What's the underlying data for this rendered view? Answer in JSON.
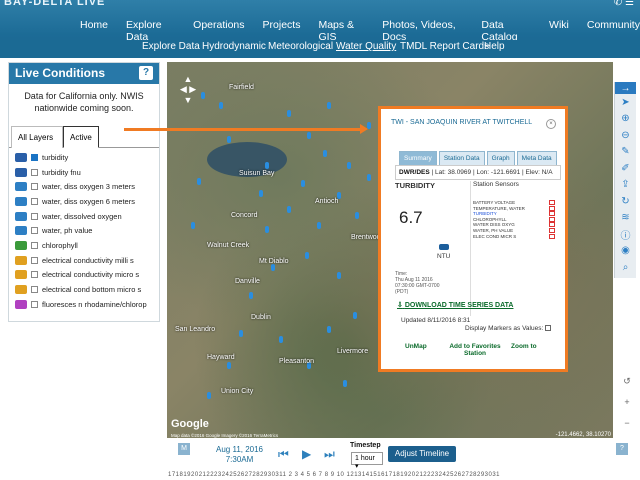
{
  "header": {
    "brand": "BAY-DELTA LIVE",
    "nav_primary": [
      "Home",
      "Explore Data",
      "Operations",
      "Projects",
      "Maps & GIS",
      "Photos, Videos, Docs",
      "Data Catalog",
      "Wiki",
      "Community"
    ],
    "nav_secondary": [
      "Explore Data",
      "Hydrodynamic",
      "Meteorological",
      "Water Quality",
      "TMDL Report Cards",
      "Help"
    ],
    "active_secondary": "Water Quality"
  },
  "panel": {
    "title": "Live Conditions",
    "help": "?",
    "note": "Data for California only. NWIS nationwide coming soon.",
    "tabs": [
      "All Layers",
      "Active"
    ],
    "layers": [
      {
        "label": "turbidity",
        "checked": true,
        "icon_color": "#2a5fa8"
      },
      {
        "label": "turbidity fnu",
        "checked": false,
        "icon_color": "#2a5fa8"
      },
      {
        "label": "water, diss oxygen 3 meters",
        "checked": false,
        "icon_color": "#2d7fc4"
      },
      {
        "label": "water, diss oxygen 6 meters",
        "checked": false,
        "icon_color": "#2d7fc4"
      },
      {
        "label": "water, dissolved oxygen",
        "checked": false,
        "icon_color": "#2d7fc4"
      },
      {
        "label": "water, ph value",
        "checked": false,
        "icon_color": "#2d7fc4"
      },
      {
        "label": "chlorophyll",
        "checked": false,
        "icon_color": "#3a9a3a"
      },
      {
        "label": "electrical conductivity milli s",
        "checked": false,
        "icon_color": "#e0a020"
      },
      {
        "label": "electrical conductivity micro s",
        "checked": false,
        "icon_color": "#e0a020"
      },
      {
        "label": "electrical cond bottom micro s",
        "checked": false,
        "icon_color": "#e0a020"
      },
      {
        "label": "fluoresces n rhodamine/chlorop",
        "checked": false,
        "icon_color": "#b040c0"
      }
    ]
  },
  "map": {
    "labels": [
      "Fairfield",
      "Suisun Bay",
      "Concord",
      "Walnut Creek",
      "Antioch",
      "Brentwood",
      "Pleasanton",
      "Livermore",
      "Hayward",
      "San Leandro",
      "Mt Diablo",
      "Union City",
      "Dublin",
      "Danville"
    ],
    "google": "Google",
    "attribution": "Map data ©2016 Google Imagery ©2016 TerraMetrics",
    "coords": "-121.4662, 38.10270"
  },
  "popup": {
    "title": "TWI - SAN JOAQUIN RIVER AT TWITCHELL",
    "close": "×",
    "tabs": [
      "Summary",
      "Station Data",
      "Graph",
      "Meta Data"
    ],
    "active_tab": "Summary",
    "info_source": "DWR/DES",
    "info_rest": "| Lat: 38.0969 | Lon: -121.6691 | Elev: N/A",
    "parameter": "TURBIDITY",
    "value": "6.7",
    "unit": "NTU",
    "time_label": "Time:",
    "time_value": "Thu Aug 11 2016 07:30:00 GMT-0700 (PDT)",
    "sensors_title": "Station Sensors",
    "sensors": [
      "BATTERY VOLTAGE",
      "TEMPERATURE, WATER",
      "TURBIDITY",
      "CHLOROPHYLL",
      "WATER DISS OXYG",
      "WATER, PH VALUE",
      "ELEC COND MICR S"
    ],
    "highlight_sensor": "TURBIDITY",
    "download": "DOWNLOAD TIME SERIES DATA",
    "updated": "Updated 8/11/2016 8:31",
    "display_values": "Display Markers as Values:",
    "links": [
      "UnMap",
      "Add to Favorites Station",
      "Zoom to"
    ]
  },
  "timeline": {
    "m_badge": "M",
    "date_line1": "Aug 11, 2016",
    "date_line2": "7:30AM",
    "timestep_label": "Timestep",
    "timestep_value": "1 hour",
    "adjust": "Adjust Timeline",
    "help": "?",
    "ticks": "1718192021222324252627282930311 2 3 4 5 6 7 8 9 10 1213141516171819202122232425262728293031"
  }
}
